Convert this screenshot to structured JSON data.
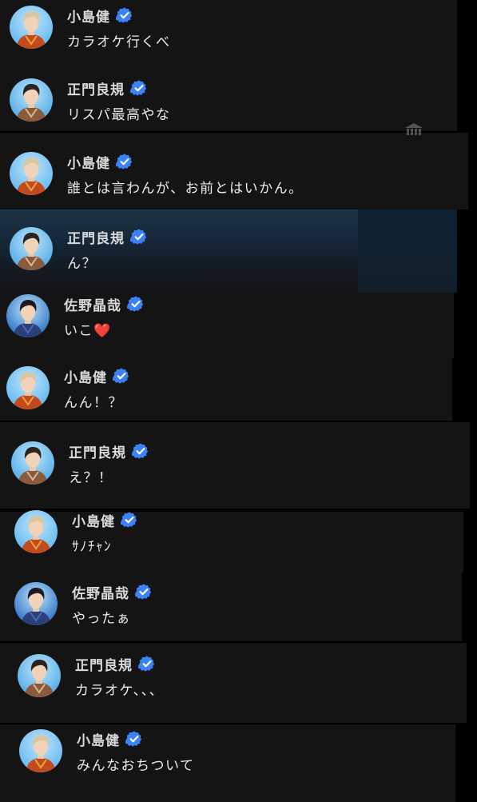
{
  "messages": [
    {
      "avatar": "kenji",
      "name": "小島健",
      "text": "カラオケ行くべ"
    },
    {
      "avatar": "yoshinori",
      "name": "正門良規",
      "text": "リスパ最高やな"
    },
    {
      "avatar": "kenji",
      "name": "小島健",
      "text": "誰とは言わんが、お前とはいかん。"
    },
    {
      "avatar": "yoshinori",
      "name": "正門良規",
      "text": "ん？"
    },
    {
      "avatar": "akiya",
      "name": "佐野晶哉",
      "text": "いこ",
      "emoji": "❤️"
    },
    {
      "avatar": "kenji",
      "name": "小島健",
      "text": "んん！？"
    },
    {
      "avatar": "yoshinori",
      "name": "正門良規",
      "text": "え？！"
    },
    {
      "avatar": "kenji",
      "name": "小島健",
      "text": "ｻﾉﾁｬﾝ"
    },
    {
      "avatar": "akiya",
      "name": "佐野晶哉",
      "text": "やったぁ"
    },
    {
      "avatar": "yoshinori",
      "name": "正門良規",
      "text": "カラオケ、、、"
    },
    {
      "avatar": "kenji",
      "name": "小島健",
      "text": "みんなおちついて"
    }
  ],
  "colors": {
    "background": "#000000",
    "panel": "#141414",
    "badge": "#3b82f6",
    "avatar_sky": "#5fb2e8",
    "heart": "#e0252f"
  },
  "icons": {
    "verified": "verified-check-icon",
    "corner": "building-icon"
  }
}
